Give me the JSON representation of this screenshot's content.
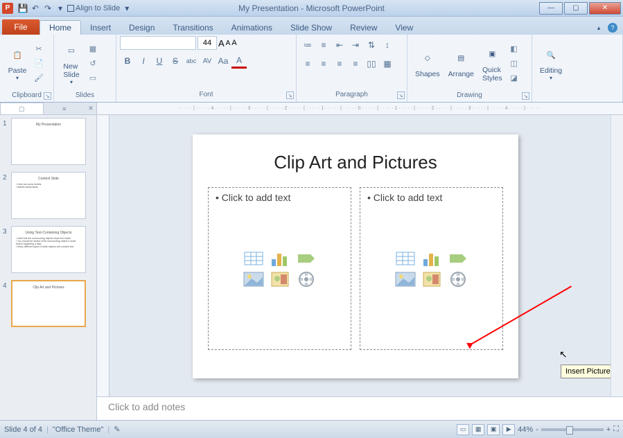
{
  "titlebar": {
    "app_letter": "P",
    "quick_options": {
      "align": "Align to Slide"
    },
    "title": "My Presentation - Microsoft PowerPoint",
    "min": "—",
    "max": "▢",
    "close": "✕"
  },
  "tabs": {
    "file": "File",
    "items": [
      "Home",
      "Insert",
      "Design",
      "Transitions",
      "Animations",
      "Slide Show",
      "Review",
      "View"
    ],
    "active": 0
  },
  "ribbon": {
    "clipboard": {
      "paste": "Paste",
      "label": "Clipboard"
    },
    "slides": {
      "new_slide": "New\nSlide",
      "label": "Slides"
    },
    "font": {
      "name_value": "",
      "size_value": "44",
      "label": "Font",
      "bold": "B",
      "italic": "I",
      "underline": "U",
      "strike": "S",
      "shadow": "abc",
      "spacing": "AV",
      "case": "Aa",
      "color": "A"
    },
    "paragraph": {
      "label": "Paragraph"
    },
    "drawing": {
      "shapes": "Shapes",
      "arrange": "Arrange",
      "quick": "Quick\nStyles",
      "label": "Drawing"
    },
    "editing": {
      "label": "Editing",
      "btn": "Editing"
    }
  },
  "thumbs": [
    {
      "n": "1",
      "title": "My Presentation",
      "body": ""
    },
    {
      "n": "2",
      "title": "Content Slide",
      "body": "• Here are some bullets\n• Bullets about ideas"
    },
    {
      "n": "3",
      "title": "Using Text-Containing Objects",
      "body": "• Note that the surrounding objects have text inside\n• You should be aware of the surrounding object's mode before beginning a task\n• Many different types of slide objects can contain text"
    },
    {
      "n": "4",
      "title": "Clip Art and Pictures",
      "body": ""
    }
  ],
  "active_thumb": 3,
  "ruler_h": "·····|·····4·····|·····3·····|·····2·····|·····1·····|·····0·····|·····1·····|·····2·····|·····3·····|·····4·····|·····",
  "slide": {
    "title": "Clip Art and Pictures",
    "placeholder": "Click to add text",
    "tooltip": "Insert Picture from File"
  },
  "content_icons": {
    "table": "table-icon",
    "chart": "chart-icon",
    "smartart": "smartart-icon",
    "picture": "picture-icon",
    "clipart": "clipart-icon",
    "media": "media-icon"
  },
  "notes": "Click to add notes",
  "statusbar": {
    "slide_pos": "Slide 4 of 4",
    "theme": "\"Office Theme\"",
    "zoom": "44%",
    "minus": "-",
    "plus": "+",
    "fit": "⛶"
  }
}
